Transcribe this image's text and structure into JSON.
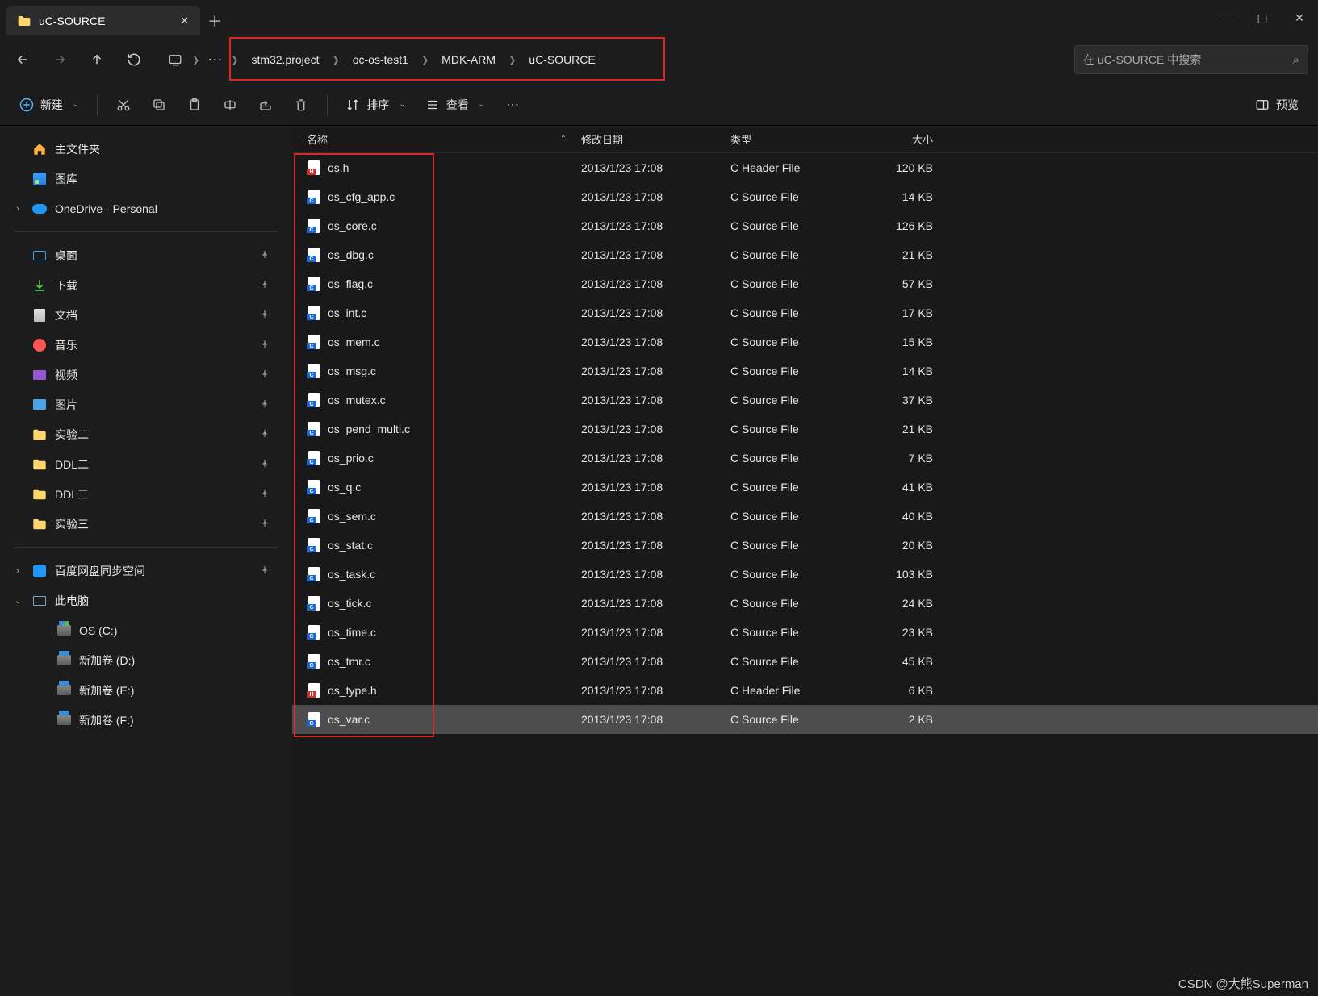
{
  "window": {
    "title": "uC-SOURCE"
  },
  "breadcrumb": [
    "stm32.project",
    "oc-os-test1",
    "MDK-ARM",
    "uC-SOURCE"
  ],
  "search": {
    "placeholder": "在 uC-SOURCE 中搜索"
  },
  "toolbar": {
    "new": "新建",
    "sort": "排序",
    "view": "查看",
    "preview": "预览"
  },
  "columns": {
    "name": "名称",
    "modified": "修改日期",
    "type": "类型",
    "size": "大小"
  },
  "sidebar": {
    "top": [
      {
        "icon": "home",
        "label": "主文件夹"
      },
      {
        "icon": "gallery",
        "label": "图库"
      },
      {
        "icon": "onedrive",
        "label": "OneDrive - Personal",
        "expander": "›"
      }
    ],
    "quick": [
      {
        "icon": "desktop",
        "label": "桌面",
        "pin": true
      },
      {
        "icon": "download",
        "label": "下载",
        "pin": true
      },
      {
        "icon": "doc",
        "label": "文档",
        "pin": true
      },
      {
        "icon": "music",
        "label": "音乐",
        "pin": true
      },
      {
        "icon": "video",
        "label": "视频",
        "pin": true
      },
      {
        "icon": "pic",
        "label": "图片",
        "pin": true
      },
      {
        "icon": "yfolder",
        "label": "实验二",
        "pin": true
      },
      {
        "icon": "yfolder",
        "label": "DDL二",
        "pin": true
      },
      {
        "icon": "yfolder",
        "label": "DDL三",
        "pin": true
      },
      {
        "icon": "yfolder",
        "label": "实验三",
        "pin": true
      }
    ],
    "locations": [
      {
        "icon": "baidu",
        "label": "百度网盘同步空间",
        "expander": "›",
        "pin": true
      },
      {
        "icon": "pc",
        "label": "此电脑",
        "expander": "⌄"
      }
    ],
    "drives": [
      {
        "icon": "os",
        "label": "OS (C:)"
      },
      {
        "icon": "drive",
        "label": "新加卷 (D:)"
      },
      {
        "icon": "drive",
        "label": "新加卷 (E:)"
      },
      {
        "icon": "drive",
        "label": "新加卷 (F:)"
      }
    ]
  },
  "files": [
    {
      "name": "os.h",
      "ext": "h",
      "modified": "2013/1/23 17:08",
      "type": "C Header File",
      "size": "120 KB"
    },
    {
      "name": "os_cfg_app.c",
      "ext": "c",
      "modified": "2013/1/23 17:08",
      "type": "C Source File",
      "size": "14 KB"
    },
    {
      "name": "os_core.c",
      "ext": "c",
      "modified": "2013/1/23 17:08",
      "type": "C Source File",
      "size": "126 KB"
    },
    {
      "name": "os_dbg.c",
      "ext": "c",
      "modified": "2013/1/23 17:08",
      "type": "C Source File",
      "size": "21 KB"
    },
    {
      "name": "os_flag.c",
      "ext": "c",
      "modified": "2013/1/23 17:08",
      "type": "C Source File",
      "size": "57 KB"
    },
    {
      "name": "os_int.c",
      "ext": "c",
      "modified": "2013/1/23 17:08",
      "type": "C Source File",
      "size": "17 KB"
    },
    {
      "name": "os_mem.c",
      "ext": "c",
      "modified": "2013/1/23 17:08",
      "type": "C Source File",
      "size": "15 KB"
    },
    {
      "name": "os_msg.c",
      "ext": "c",
      "modified": "2013/1/23 17:08",
      "type": "C Source File",
      "size": "14 KB"
    },
    {
      "name": "os_mutex.c",
      "ext": "c",
      "modified": "2013/1/23 17:08",
      "type": "C Source File",
      "size": "37 KB"
    },
    {
      "name": "os_pend_multi.c",
      "ext": "c",
      "modified": "2013/1/23 17:08",
      "type": "C Source File",
      "size": "21 KB"
    },
    {
      "name": "os_prio.c",
      "ext": "c",
      "modified": "2013/1/23 17:08",
      "type": "C Source File",
      "size": "7 KB"
    },
    {
      "name": "os_q.c",
      "ext": "c",
      "modified": "2013/1/23 17:08",
      "type": "C Source File",
      "size": "41 KB"
    },
    {
      "name": "os_sem.c",
      "ext": "c",
      "modified": "2013/1/23 17:08",
      "type": "C Source File",
      "size": "40 KB"
    },
    {
      "name": "os_stat.c",
      "ext": "c",
      "modified": "2013/1/23 17:08",
      "type": "C Source File",
      "size": "20 KB"
    },
    {
      "name": "os_task.c",
      "ext": "c",
      "modified": "2013/1/23 17:08",
      "type": "C Source File",
      "size": "103 KB"
    },
    {
      "name": "os_tick.c",
      "ext": "c",
      "modified": "2013/1/23 17:08",
      "type": "C Source File",
      "size": "24 KB"
    },
    {
      "name": "os_time.c",
      "ext": "c",
      "modified": "2013/1/23 17:08",
      "type": "C Source File",
      "size": "23 KB"
    },
    {
      "name": "os_tmr.c",
      "ext": "c",
      "modified": "2013/1/23 17:08",
      "type": "C Source File",
      "size": "45 KB"
    },
    {
      "name": "os_type.h",
      "ext": "h",
      "modified": "2013/1/23 17:08",
      "type": "C Header File",
      "size": "6 KB"
    },
    {
      "name": "os_var.c",
      "ext": "c",
      "modified": "2013/1/23 17:08",
      "type": "C Source File",
      "size": "2 KB",
      "selected": true
    }
  ],
  "watermark": "CSDN @大熊Superman"
}
